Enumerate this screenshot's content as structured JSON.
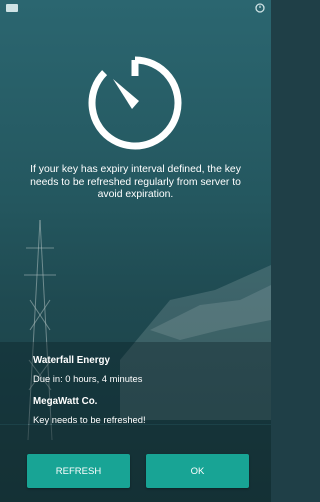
{
  "status_bar": {
    "left_icon": "notification-icon",
    "right_icon": "alarm-icon"
  },
  "dialog": {
    "icon": "timer-icon",
    "message": "If your key has expiry interval defined, the key needs to be refreshed regularly from server to avoid expiration."
  },
  "reminders": [
    {
      "title": "Waterfall Energy",
      "status": "Due in: 0 hours, 4 minutes"
    },
    {
      "title": "MegaWatt Co.",
      "status": "Key needs to be refreshed!"
    }
  ],
  "buttons": {
    "refresh_label": "REFRESH",
    "ok_label": "OK"
  },
  "colors": {
    "accent": "#18a495",
    "background": "#24575f",
    "text": "#ffffff"
  }
}
